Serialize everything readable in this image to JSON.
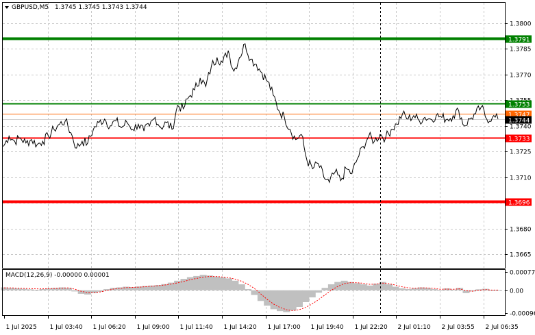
{
  "header": {
    "symbol": "GBPUSD,M5",
    "quote": "1.3745 1.3745 1.3743 1.3744"
  },
  "colors": {
    "grid": "#c8c8c8",
    "price": "#000000",
    "green_level": "#008000",
    "red_level": "#ff0000",
    "orange_level": "#ff6600",
    "histogram": "#c0c0c0",
    "signal": "#ff0000",
    "vline": "#000000"
  },
  "chart_data": [
    {
      "type": "line",
      "title": "GBPUSD,M5",
      "subtitle": "1.3745 1.3745 1.3743 1.3744",
      "ylim": [
        1.3657,
        1.3812
      ],
      "y_ticks": [
        "1.3800",
        "1.3785",
        "1.3770",
        "1.3755",
        "1.3740",
        "1.3725",
        "1.3710",
        "1.3695",
        "1.3680",
        "1.3665"
      ],
      "x_ticks": [
        "1 Jul 2025",
        "1 Jul 03:40",
        "1 Jul 06:20",
        "1 Jul 09:00",
        "1 Jul 11:40",
        "1 Jul 14:20",
        "1 Jul 17:00",
        "1 Jul 19:40",
        "1 Jul 22:20",
        "2 Jul 01:10",
        "2 Jul 03:55",
        "2 Jul 06:35"
      ],
      "levels": [
        {
          "value": 1.3791,
          "label": "1.3791",
          "color": "green",
          "style": "thick"
        },
        {
          "value": 1.3753,
          "label": "1.3753",
          "color": "green",
          "style": "normal"
        },
        {
          "value": 1.3747,
          "label": "1.3747",
          "color": "orange",
          "style": "thin"
        },
        {
          "value": 1.3744,
          "label": "1.3744",
          "color": "black",
          "style": "price"
        },
        {
          "value": 1.3733,
          "label": "1.3733",
          "color": "red",
          "style": "normal"
        },
        {
          "value": 1.3696,
          "label": "1.3696",
          "color": "red",
          "style": "thick"
        }
      ],
      "series": [
        {
          "values": [
            1.3728,
            1.3734,
            1.3731,
            1.3733,
            1.373,
            1.3732,
            1.3729,
            1.3731,
            1.3734,
            1.3738,
            1.3741,
            1.3743,
            1.3736,
            1.3727,
            1.3731,
            1.373,
            1.3738,
            1.3742,
            1.3744,
            1.374,
            1.3743,
            1.3739,
            1.3742,
            1.3738,
            1.3741,
            1.3737,
            1.374,
            1.3745,
            1.3739,
            1.3742,
            1.3738,
            1.3752,
            1.375,
            1.3757,
            1.3761,
            1.3768,
            1.3763,
            1.3775,
            1.378,
            1.3777,
            1.3784,
            1.3772,
            1.378,
            1.3788,
            1.3779,
            1.3776,
            1.3771,
            1.3766,
            1.3758,
            1.3749,
            1.3745,
            1.3738,
            1.3732,
            1.3735,
            1.372,
            1.3715,
            1.3718,
            1.371,
            1.3707,
            1.3713,
            1.3708,
            1.3715,
            1.3712,
            1.3721,
            1.3728,
            1.3734,
            1.3731,
            1.3735,
            1.3733,
            1.3738,
            1.3741,
            1.3747,
            1.3744,
            1.3746,
            1.3743,
            1.3745,
            1.3744,
            1.3746,
            1.3745,
            1.3744,
            1.3746,
            1.3749,
            1.374,
            1.3744,
            1.3747,
            1.3751,
            1.3744,
            1.3745,
            1.3744
          ]
        }
      ]
    },
    {
      "type": "bar",
      "title": "MACD(12,26,9) -0.00000 0.00001",
      "ylim": [
        -0.00096,
        0.00077
      ],
      "y_ticks": [
        "0.00077",
        "0.00",
        "-0.00096"
      ],
      "series": [
        {
          "name": "histogram",
          "values": [
            0.00012,
            0.0001,
            8e-05,
            6e-05,
            4e-05,
            2e-05,
            5e-05,
            8e-05,
            0.0001,
            0.00012,
            0.0001,
            -5e-05,
            -0.00015,
            -0.00018,
            -0.00012,
            -6e-05,
            5e-05,
            0.0001,
            0.00012,
            0.00015,
            0.00013,
            0.00016,
            0.00018,
            0.0002,
            0.00022,
            0.00026,
            0.00032,
            0.0004,
            0.00048,
            0.00055,
            0.0006,
            0.00065,
            0.00062,
            0.00058,
            0.00055,
            0.0005,
            0.0004,
            0.00025,
            5e-05,
            -0.0002,
            -0.00045,
            -0.00065,
            -0.0008,
            -0.00088,
            -0.00092,
            -0.00085,
            -0.0007,
            -0.0005,
            -0.0003,
            -0.0001,
            0.0001,
            0.00025,
            0.00035,
            0.0004,
            0.00035,
            0.0003,
            0.00025,
            0.0002,
            0.00028,
            0.00035,
            0.00025,
            0.00015,
            8e-05,
            5e-05,
            8e-05,
            0.00012,
            0.0001,
            5e-05,
            -2e-05,
            8e-05,
            3e-05,
            0.0001,
            -0.00012,
            -5e-05,
            4e-05,
            6e-05,
            -2e-05,
            1e-05
          ]
        },
        {
          "name": "signal",
          "values": [
            0.0001,
            0.0001,
            9e-05,
            8e-05,
            7e-05,
            6e-05,
            6e-05,
            7e-05,
            8e-05,
            9e-05,
            0.0001,
            5e-05,
            -4e-05,
            -0.0001,
            -0.0001,
            -7e-05,
            -1e-05,
            5e-05,
            8e-05,
            0.00011,
            0.00012,
            0.00013,
            0.00015,
            0.00017,
            0.00019,
            0.00022,
            0.00026,
            0.00031,
            0.00037,
            0.00044,
            0.0005,
            0.00055,
            0.00058,
            0.00058,
            0.00056,
            0.00053,
            0.00047,
            0.00038,
            0.00025,
            8e-05,
            -0.00015,
            -0.00038,
            -0.00058,
            -0.00072,
            -0.00082,
            -0.00086,
            -0.00082,
            -0.00072,
            -0.00058,
            -0.0004,
            -0.0002,
            0.0,
            0.00016,
            0.00028,
            0.00032,
            0.00032,
            0.00029,
            0.00025,
            0.00026,
            0.0003,
            0.00028,
            0.00022,
            0.00015,
            0.0001,
            9e-05,
            0.0001,
            0.0001,
            8e-05,
            4e-05,
            5e-05,
            4e-05,
            6e-05,
            -2e-05,
            -4e-05,
            0.0,
            3e-05,
            1e-05,
            1e-05
          ]
        }
      ]
    }
  ]
}
